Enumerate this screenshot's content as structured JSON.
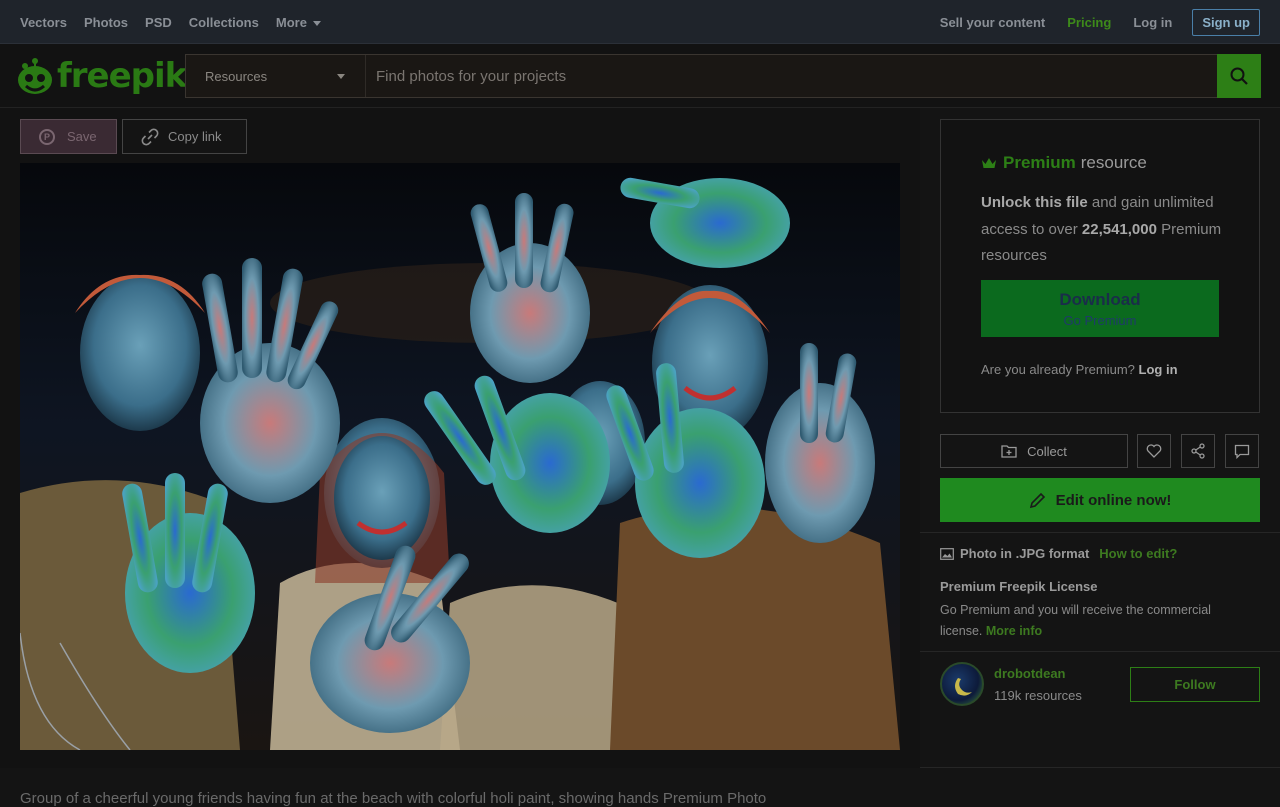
{
  "topnav": {
    "left": [
      {
        "label": "Vectors"
      },
      {
        "label": "Photos"
      },
      {
        "label": "PSD"
      },
      {
        "label": "Collections"
      },
      {
        "label": "More"
      }
    ],
    "right": {
      "sell": "Sell your content",
      "pricing": "Pricing",
      "login": "Log in",
      "signup": "Sign up"
    }
  },
  "logo": {
    "text": "freepik"
  },
  "search": {
    "category": "Resources",
    "placeholder": "Find photos for your projects"
  },
  "toolbar": {
    "save_label": "Save",
    "copy_label": "Copy link"
  },
  "premium": {
    "title_bold": "Premium",
    "title_rest": "resource",
    "unlock_bold": "Unlock this file",
    "unlock_rest": "and gain unlimited access to over",
    "count_bold": "22,541,000",
    "count_rest": "Premium resources",
    "download_label": "Download",
    "download_sub": "Go Premium",
    "already_text": "Are you already Premium?",
    "already_link": "Log in"
  },
  "actions": {
    "collect_label": "Collect",
    "edit_label": "Edit online now!"
  },
  "info": {
    "format_text": "Photo in .JPG format",
    "howto_link": "How to edit?",
    "license_title": "Premium Freepik License",
    "license_text": "Go Premium and you will receive the commercial license.",
    "license_link": "More info"
  },
  "author": {
    "name": "drobotdean",
    "resources": "119k resources",
    "follow_label": "Follow"
  },
  "caption": "Group of a cheerful young friends having fun at the beach with colorful holi paint, showing hands Premium Photo",
  "colors": {
    "brand_green": "#2d7f16",
    "topbar_bg": "#1f242b",
    "page_bg": "#141414"
  }
}
